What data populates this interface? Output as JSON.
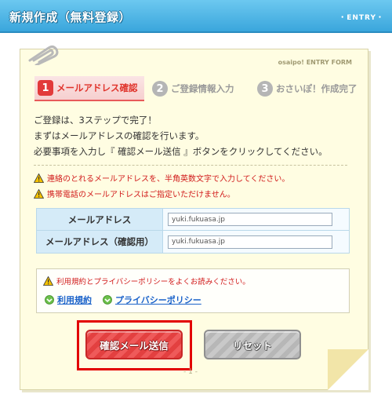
{
  "header": {
    "title": "新規作成（無料登録）",
    "tag": "・ENTRY・"
  },
  "form": {
    "label": "osaipo! ENTRY FORM"
  },
  "steps": [
    {
      "num": "1",
      "label": "メールアドレス確認"
    },
    {
      "num": "2",
      "label": "ご登録情報入力"
    },
    {
      "num": "3",
      "label": "おさいぽ！作成完了"
    }
  ],
  "intro": [
    "ご登録は、3ステップで完了！",
    "まずはメールアドレスの確認を行います。",
    "必要事項を入力し『 確認メール送信 』ボタンをクリックしてください。"
  ],
  "warnings": [
    "連絡のとれるメールアドレスを、半角英数文字で入力してください。",
    "携帯電話のメールアドレスはご指定いただけません。"
  ],
  "fields": [
    {
      "label": "メールアドレス",
      "value": "yuki.fukuasa.jp"
    },
    {
      "label": "メールアドレス（確認用）",
      "value": "yuki.fukuasa.jp"
    }
  ],
  "policy": {
    "notice": "利用規約とプライバシーポリシーをよくお読みください。",
    "terms_link": "利用規約",
    "privacy_link": "プライバシーポリシー"
  },
  "buttons": {
    "confirm": "確認メール送信",
    "reset": "リセット"
  },
  "page_indicator": "- 1 -",
  "colors": {
    "header": "#3aa6dc",
    "paper": "#fffde2",
    "accent_red": "#e23a3a",
    "link_blue": "#1a62c9",
    "highlight": "#e20000"
  },
  "icons": [
    "paperclip-icon",
    "warning-icon",
    "arrow-link-icon"
  ]
}
